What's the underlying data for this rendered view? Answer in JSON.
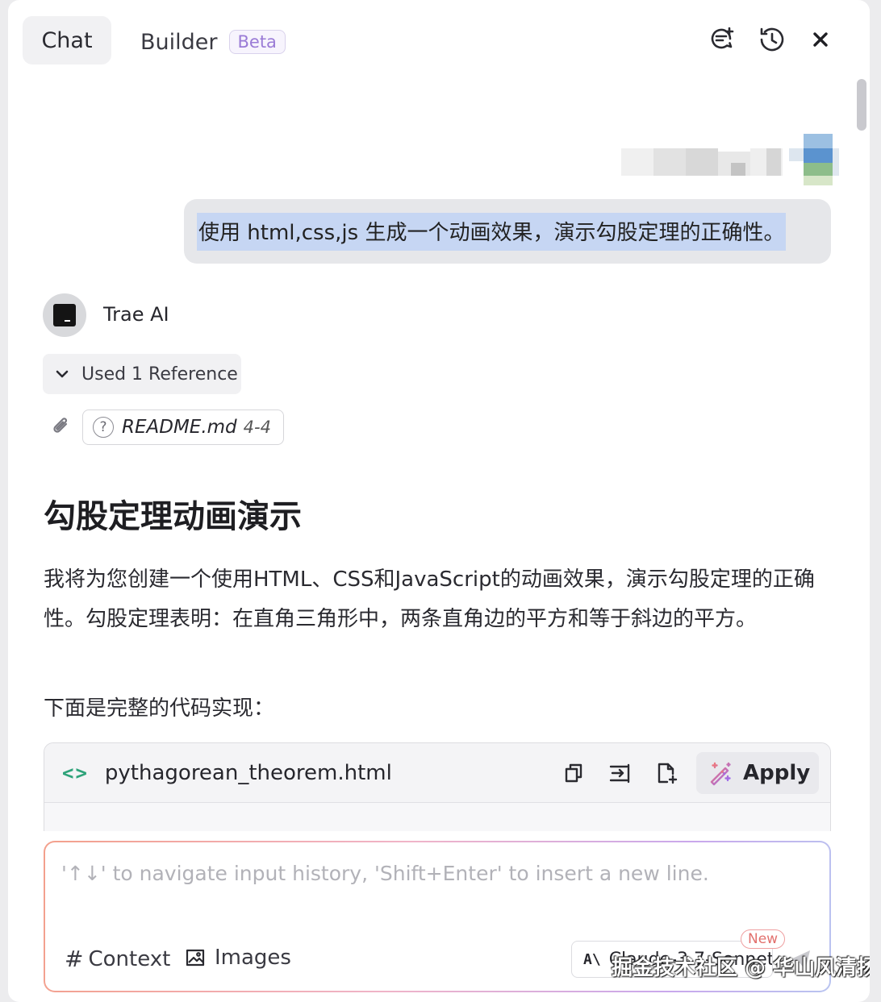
{
  "header": {
    "tabs": [
      {
        "label": "Chat",
        "active": true
      },
      {
        "label": "Builder",
        "active": false,
        "badge": "Beta"
      }
    ],
    "icons": [
      "new-chat-icon",
      "history-icon",
      "close-icon"
    ]
  },
  "conversation": {
    "user_message": "使用 html,css,js 生成一个动画效果，演示勾股定理的正确性。",
    "assistant_name": "Trae AI",
    "reference_toggle": "Used 1 Reference",
    "reference_file": "README.md",
    "reference_range": "4-4",
    "response_title": "勾股定理动画演示",
    "response_paragraph": "我将为您创建一个使用HTML、CSS和JavaScript的动画效果，演示勾股定理的正确性。勾股定理表明：在直角三角形中，两条直角边的平方和等于斜边的平方。",
    "response_intro_code": "下面是完整的代码实现：",
    "code_block": {
      "filename": "pythagorean_theorem.html",
      "apply_label": "Apply",
      "actions": [
        "copy-icon",
        "insert-at-cursor-icon",
        "new-file-icon"
      ]
    }
  },
  "input": {
    "placeholder": "'↑↓' to navigate input history, 'Shift+Enter' to insert a new line.",
    "context_label": "Context",
    "images_label": "Images",
    "model_name": "Claude-3.7-Sonnet",
    "model_badge": "New"
  },
  "watermark": "掘金技术社区 @ 华山风清扬",
  "colors": {
    "accent_code_icon": "#2fa37a",
    "beta_badge": "#9a7bd6",
    "user_highlight": "#c6d6f3"
  }
}
